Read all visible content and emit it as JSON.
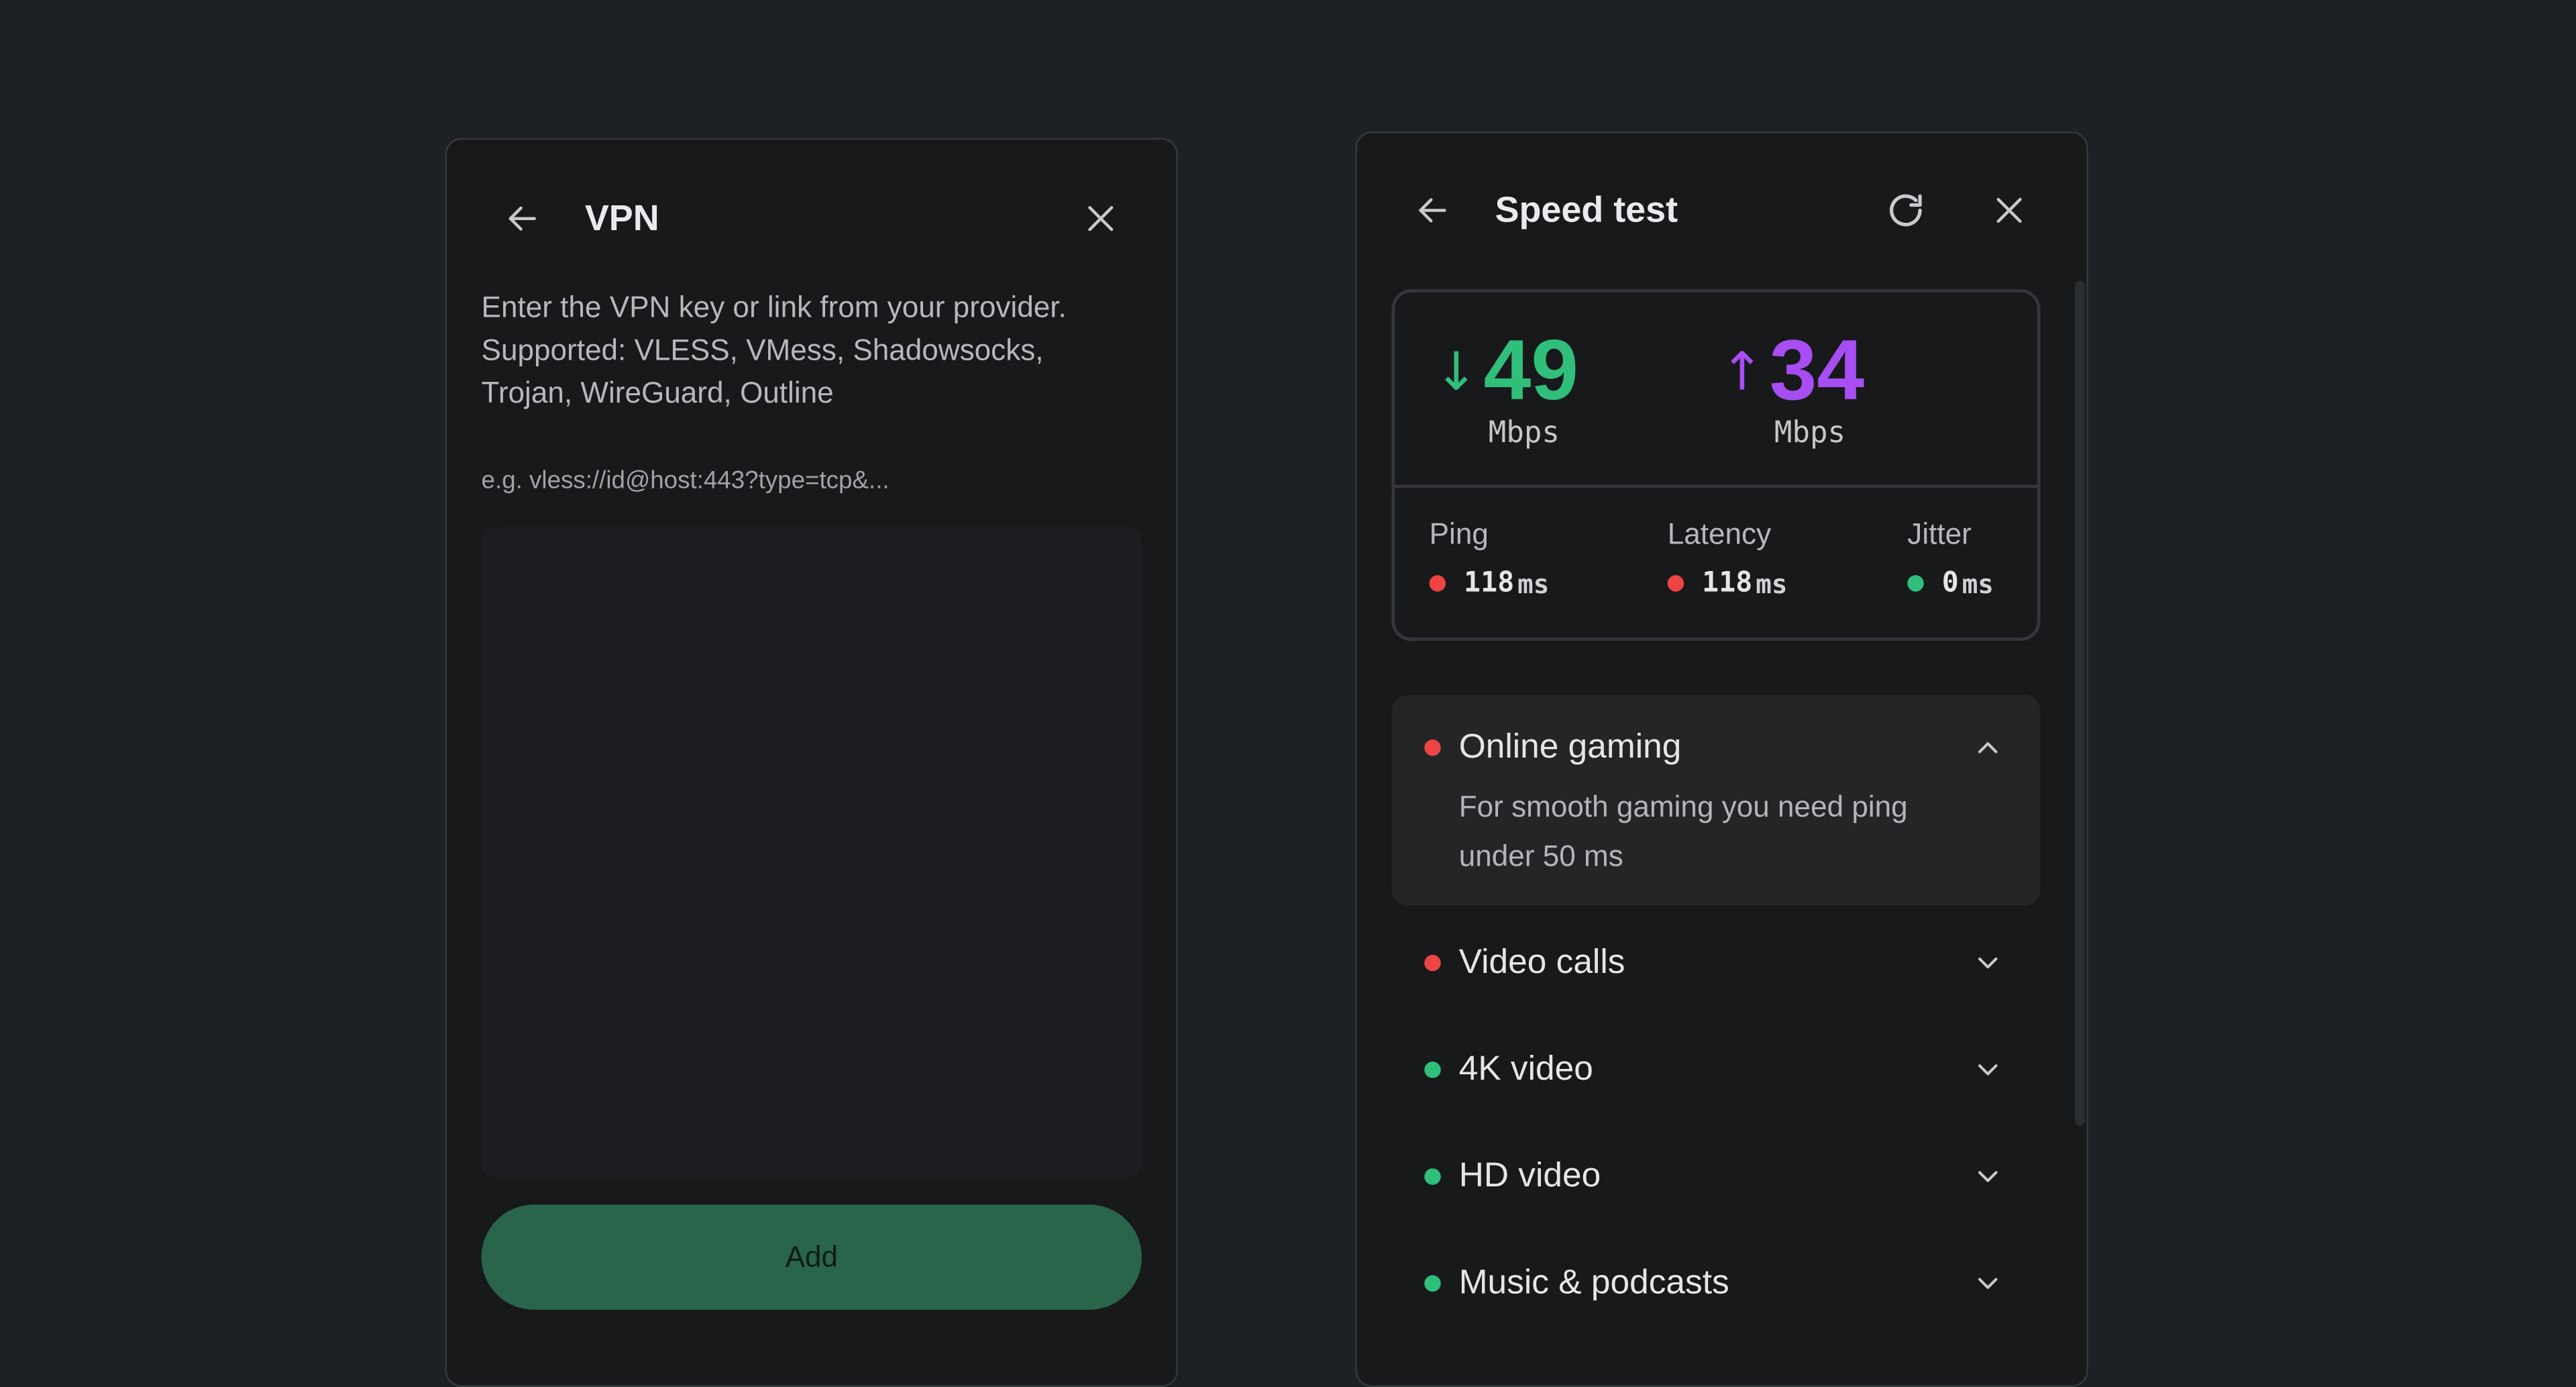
{
  "colors": {
    "background": "#1d2125",
    "panel": "#17191b",
    "accent_green": "#2fbf7b",
    "accent_purple": "#a64ef2",
    "status_red": "#ee4444",
    "add_button": "#28654a"
  },
  "vpn": {
    "title": "VPN",
    "back_icon": "arrow-left-icon",
    "close_icon": "close-icon",
    "description": "Enter the VPN key or link from your provider. Supported: VLESS, VMess, Shadowsocks, Trojan, WireGuard, Outline",
    "input_placeholder": "e.g. vless://id@host:443?type=tcp&...",
    "input_value": "",
    "add_label": "Add"
  },
  "speed_test": {
    "title": "Speed test",
    "back_icon": "arrow-left-icon",
    "refresh_icon": "refresh-icon",
    "close_icon": "close-icon",
    "download": {
      "arrow": "↓",
      "value": "49",
      "unit": "Mbps"
    },
    "upload": {
      "arrow": "↑",
      "value": "34",
      "unit": "Mbps"
    },
    "latency_metrics": [
      {
        "label": "Ping",
        "value": "118",
        "unit": "ms",
        "status": "red"
      },
      {
        "label": "Latency",
        "value": "118",
        "unit": "ms",
        "status": "red"
      },
      {
        "label": "Jitter",
        "value": "0",
        "unit": "ms",
        "status": "green"
      }
    ],
    "use_cases": [
      {
        "label": "Online gaming",
        "status": "red",
        "expanded": true,
        "description": "For smooth gaming you need ping under 50 ms"
      },
      {
        "label": "Video calls",
        "status": "red",
        "expanded": false
      },
      {
        "label": "4K video",
        "status": "green",
        "expanded": false
      },
      {
        "label": "HD video",
        "status": "green",
        "expanded": false
      },
      {
        "label": "Music & podcasts",
        "status": "green",
        "expanded": false
      }
    ]
  }
}
